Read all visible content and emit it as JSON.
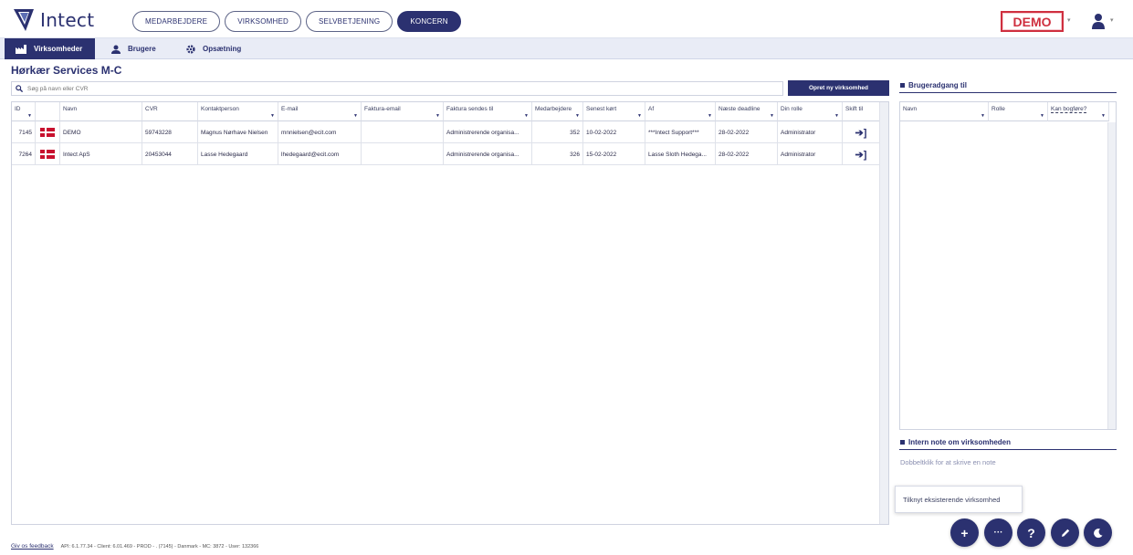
{
  "app": {
    "logo_text": "Intect"
  },
  "nav": {
    "pills": [
      "MEDARBEJDERE",
      "VIRKSOMHED",
      "SELVBETJENING",
      "KONCERN"
    ],
    "active": "KONCERN"
  },
  "env_badge": "DEMO",
  "subnav": {
    "companies": "Virksomheder",
    "users": "Brugere",
    "settings": "Opsætning"
  },
  "page": {
    "title": "Hørkær Services M-C"
  },
  "search": {
    "placeholder": "Søg på navn eller CVR"
  },
  "create_button": "Opret ny virksomhed",
  "table": {
    "headers": [
      "ID",
      "",
      "Navn",
      "CVR",
      "Kontaktperson",
      "E-mail",
      "Faktura-email",
      "Faktura sendes til",
      "Medarbejdere",
      "Senest kørt",
      "Af",
      "Næste deadline",
      "Din rolle",
      "Skift til"
    ],
    "rows": [
      {
        "id": "7145",
        "name": "DEMO",
        "cvr": "59743228",
        "contact": "Magnus Nørhave Nielsen",
        "email": "mnnielsen@ecit.com",
        "invoice_email": "",
        "invoice_to": "Administrerende organisa...",
        "employees": "352",
        "last_run": "10-02-2022",
        "by": "***Intect Support***",
        "deadline": "28-02-2022",
        "role": "Administrator"
      },
      {
        "id": "7264",
        "name": "Intect ApS",
        "cvr": "20453044",
        "contact": "Lasse Hedegaard",
        "email": "lhedegaard@ecit.com",
        "invoice_email": "",
        "invoice_to": "Administrerende organisa...",
        "employees": "326",
        "last_run": "15-02-2022",
        "by": "Lasse Sloth Hedega...",
        "deadline": "28-02-2022",
        "role": "Administrator"
      }
    ]
  },
  "user_access": {
    "title": "Brugeradgang til",
    "headers": [
      "Navn",
      "Rolle",
      "Kan bogføre?"
    ]
  },
  "internal_note": {
    "title": "Intern note om virksomheden",
    "hint": "Dobbeltklik for at skrive en note"
  },
  "tooltip": "Tilknyt eksisterende virksomhed",
  "fabs": [
    "+",
    "···",
    "?"
  ],
  "footer": {
    "feedback": "Giv os feedback",
    "info": "API: 6.1.77.34 - Client: 6.01.469 - PROD - . (7145) - Danmark - MC: 3872 - User: 132366"
  },
  "colors": {
    "primary": "#2b3170",
    "demo_red": "#cf2f3f",
    "flag_red": "#c8102e"
  }
}
